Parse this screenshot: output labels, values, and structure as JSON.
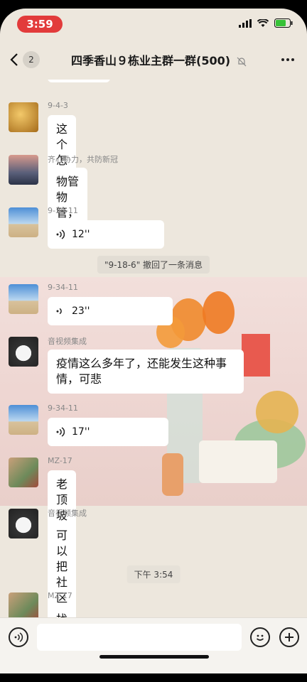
{
  "status": {
    "time": "3:59"
  },
  "nav": {
    "back_count": "2",
    "title": "四季香山９栋业主群一群(500)"
  },
  "messages": [
    {
      "sender": "9-4-3",
      "text": "这个怎么搞"
    },
    {
      "sender": "齐心协力，共防新冠",
      "text": "物管物管，"
    },
    {
      "sender": "9-34-11",
      "text": "12''"
    },
    {
      "sender": "9-34-11",
      "text": "23''"
    },
    {
      "sender": "音视频集成",
      "text": "疫情这么多年了，还能发生这种事情，可悲"
    },
    {
      "sender": "9-34-11",
      "text": "17''"
    },
    {
      "sender": "MZ-17",
      "text": "老顶坡社区不作为"
    },
    {
      "sender": "音视频集成",
      "text": "可以把社区告上法庭了"
    },
    {
      "sender": "MZ-17",
      "text": "找社区"
    }
  ],
  "system": {
    "recall": "\"9-18-6\" 撤回了一条消息",
    "timestamp": "下午 3:54"
  },
  "icons": [
    "voice-icon",
    "emoji-icon",
    "plus-icon",
    "wifi-icon",
    "battery-icon",
    "signal-icon",
    "mute-icon",
    "more-icon",
    "back-chevron-icon"
  ],
  "colors": {
    "time_pill": "#e23b3b",
    "background": "#ede7dd",
    "bubble": "#ffffff"
  }
}
